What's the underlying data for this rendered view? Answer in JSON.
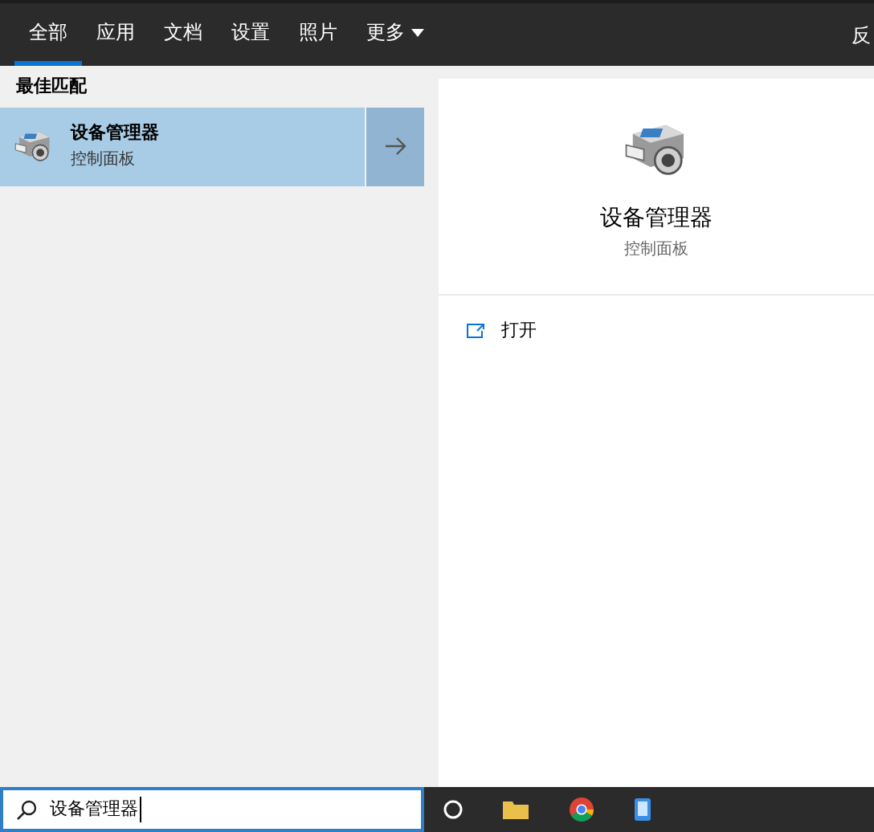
{
  "tabs": [
    {
      "label": "全部",
      "selected": true
    },
    {
      "label": "应用",
      "selected": false
    },
    {
      "label": "文档",
      "selected": false
    },
    {
      "label": "设置",
      "selected": false
    },
    {
      "label": "照片",
      "selected": false
    },
    {
      "label": "更多",
      "selected": false,
      "dropdown": true
    }
  ],
  "feedback": "反",
  "best_match": {
    "heading": "最佳匹配",
    "title": "设备管理器",
    "subtitle": "控制面板",
    "selected": true
  },
  "preview": {
    "title": "设备管理器",
    "subtitle": "控制面板",
    "actions": [
      "打开"
    ]
  },
  "search": {
    "value": "设备管理器"
  }
}
